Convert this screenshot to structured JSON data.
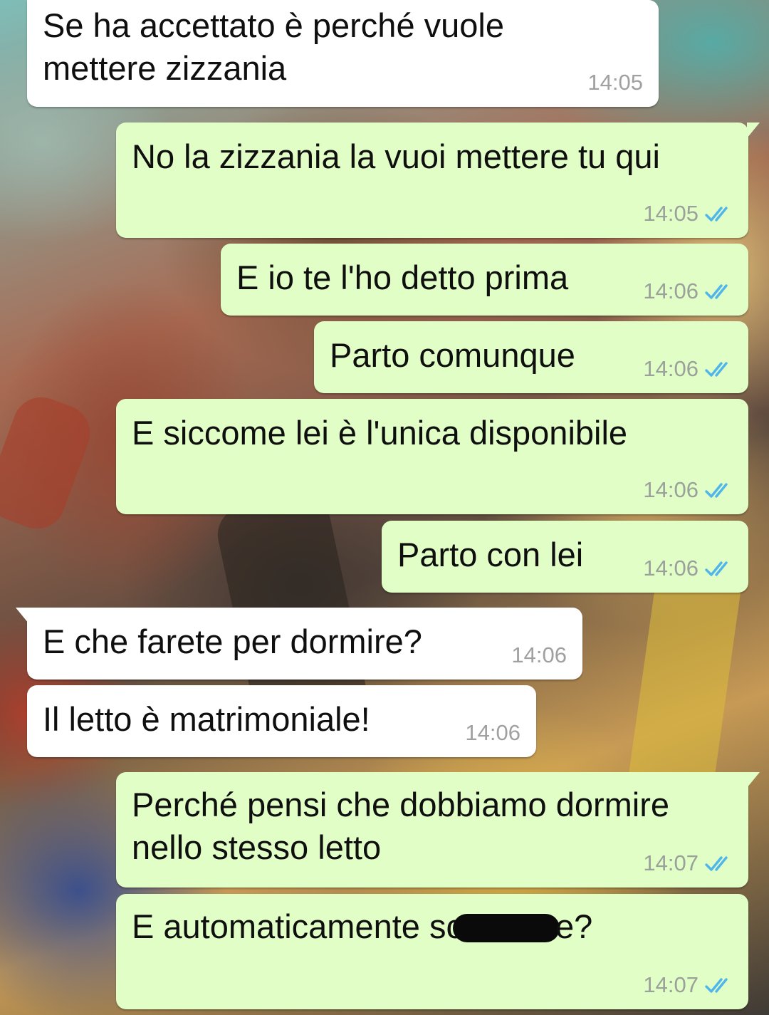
{
  "messages": [
    {
      "id": "m1",
      "direction": "incoming",
      "text": "Se ha accettato è perché vuole\nmettere zizzania",
      "time": "14:05"
    },
    {
      "id": "m2",
      "direction": "outgoing",
      "text": "No la zizzania la vuoi mettere tu qui",
      "time": "14:05",
      "status": "read"
    },
    {
      "id": "m3",
      "direction": "outgoing",
      "text": "E io te l'ho detto prima",
      "time": "14:06",
      "status": "read"
    },
    {
      "id": "m4",
      "direction": "outgoing",
      "text": "Parto comunque",
      "time": "14:06",
      "status": "read"
    },
    {
      "id": "m5",
      "direction": "outgoing",
      "text": "E siccome lei è l'unica disponibile",
      "time": "14:06",
      "status": "read"
    },
    {
      "id": "m6",
      "direction": "outgoing",
      "text": "Parto con lei",
      "time": "14:06",
      "status": "read"
    },
    {
      "id": "m7",
      "direction": "incoming",
      "text": "E che farete per dormire?",
      "time": "14:06"
    },
    {
      "id": "m8",
      "direction": "incoming",
      "text": "Il letto è matrimoniale!",
      "time": "14:06"
    },
    {
      "id": "m9",
      "direction": "outgoing",
      "text": "Perché pensi che dobbiamo dormire\nnello stesso letto",
      "time": "14:07",
      "status": "read"
    },
    {
      "id": "m10",
      "direction": "outgoing",
      "text_before_redaction": "E automaticamente sc",
      "text_after_redaction": "e?",
      "time": "14:07",
      "status": "read"
    }
  ],
  "colors": {
    "incoming_bubble": "#ffffff",
    "outgoing_bubble": "#e1fec6",
    "read_ticks": "#4fb6ec",
    "timestamp": "#9aa19a"
  },
  "icons": {
    "read_status": "double-check-icon"
  }
}
